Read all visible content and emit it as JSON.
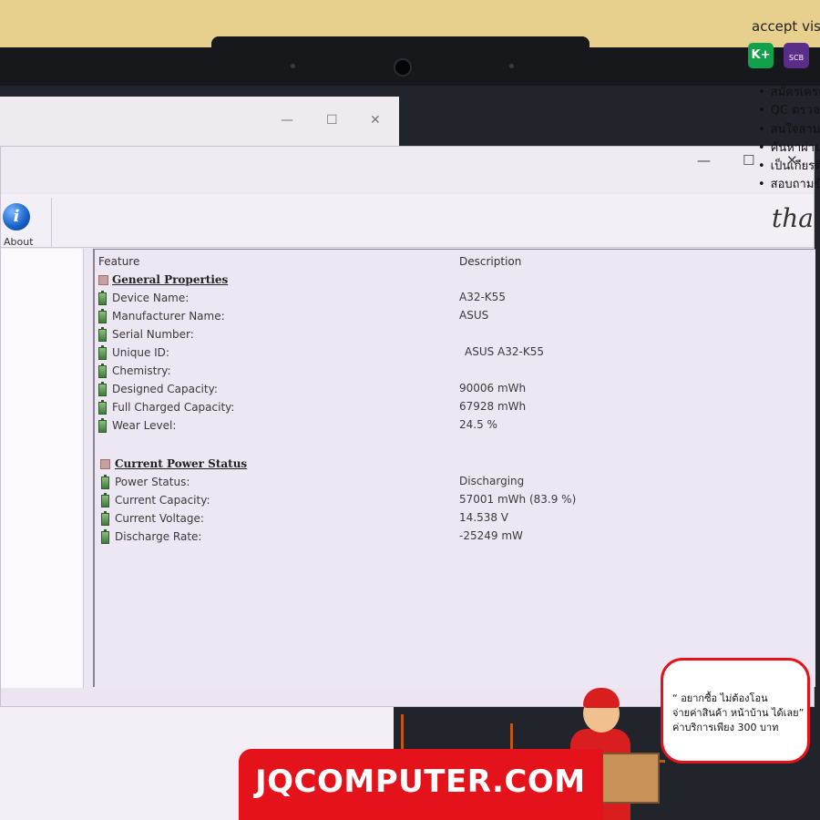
{
  "overlay": {
    "accept_text": "accept vis",
    "payments": [
      {
        "name": "kplus-logo",
        "label": "K+",
        "color": "#12a04a"
      },
      {
        "name": "scb-logo",
        "label": "SCB",
        "color": "#5a2d8a"
      }
    ],
    "bullets": [
      "สมัครเครด",
      "QC ตรวจส",
      "สนใจสามา",
      "ค้นหาผ่าน",
      "เป็นเกียรติ",
      "สอบถามข้อ"
    ]
  },
  "window": {
    "about_label": "About",
    "signature": "tha",
    "columns": {
      "feature": "Feature",
      "description": "Description"
    },
    "sections": [
      {
        "title": "General Properties",
        "rows": [
          {
            "feature": "Device Name:",
            "value": "A32-K55"
          },
          {
            "feature": "Manufacturer Name:",
            "value": "ASUS"
          },
          {
            "feature": "Serial Number:",
            "value": ""
          },
          {
            "feature": "Unique ID:",
            "value": "ASUS A32-K55"
          },
          {
            "feature": "Chemistry:",
            "value": ""
          },
          {
            "feature": "Designed Capacity:",
            "value": "90006 mWh"
          },
          {
            "feature": "Full Charged Capacity:",
            "value": "67928 mWh"
          },
          {
            "feature": "Wear Level:",
            "value": "24.5 %"
          }
        ]
      },
      {
        "title": "Current Power Status",
        "rows": [
          {
            "feature": "Power Status:",
            "value": "Discharging"
          },
          {
            "feature": "Current Capacity:",
            "value": "57001 mWh (83.9 %)"
          },
          {
            "feature": "Current Voltage:",
            "value": "14.538 V"
          },
          {
            "feature": "Discharge Rate:",
            "value": "-25249 mW"
          }
        ]
      }
    ]
  },
  "promo": {
    "site": "JQCOMPUTER.COM",
    "speech_lines": [
      "“ อยากซื้อ ไม่ต้องโอน",
      "จ่ายค่าสินค้า หน้าบ้าน ได้เลย”",
      "ค่าบริการเพียง 300 บาท"
    ]
  }
}
